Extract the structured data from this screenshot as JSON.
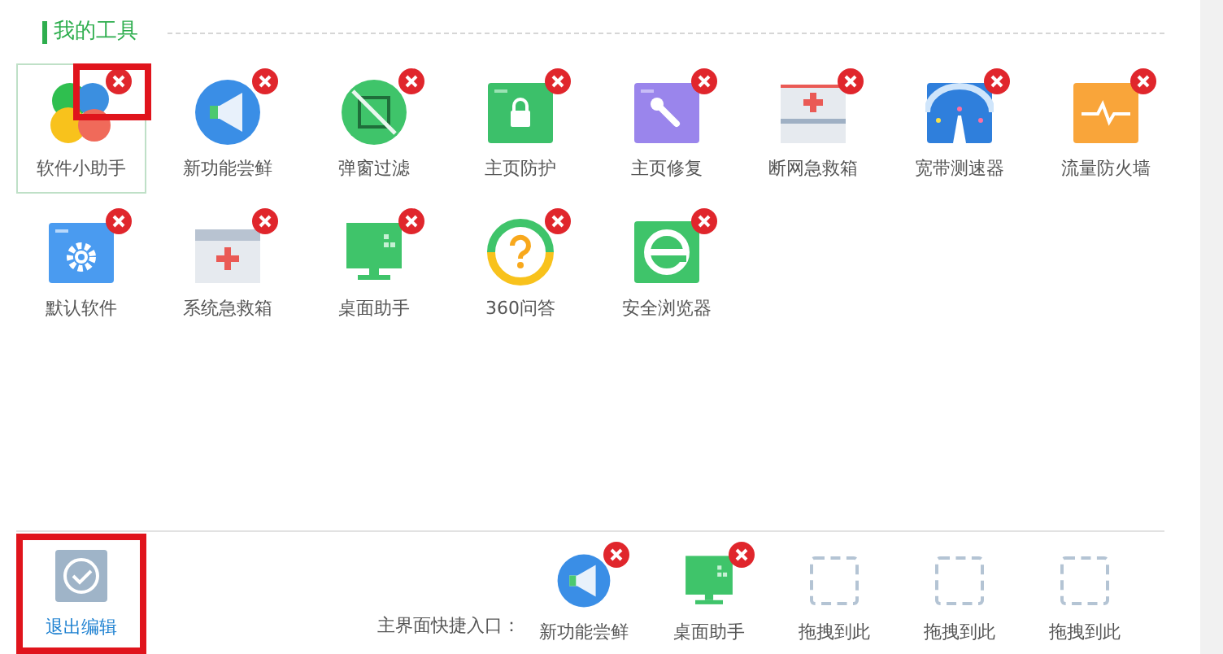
{
  "section": {
    "title": "我的工具"
  },
  "tools": [
    {
      "label": "软件小助手",
      "kind": "petals",
      "selected": true,
      "highlighted": true
    },
    {
      "label": "新功能尝鲜",
      "kind": "megaphone",
      "selected": false,
      "highlighted": false
    },
    {
      "label": "弹窗过滤",
      "kind": "nopopup",
      "selected": false,
      "highlighted": false
    },
    {
      "label": "主页防护",
      "kind": "lock",
      "selected": false,
      "highlighted": false
    },
    {
      "label": "主页修复",
      "kind": "wrench",
      "selected": false,
      "highlighted": false
    },
    {
      "label": "断网急救箱",
      "kind": "kit",
      "selected": false,
      "highlighted": false
    },
    {
      "label": "宽带测速器",
      "kind": "speed",
      "selected": false,
      "highlighted": false
    },
    {
      "label": "流量防火墙",
      "kind": "pulse",
      "selected": false,
      "highlighted": false
    },
    {
      "label": "默认软件",
      "kind": "gear",
      "selected": false,
      "highlighted": false
    },
    {
      "label": "系统急救箱",
      "kind": "kit2",
      "selected": false,
      "highlighted": false
    },
    {
      "label": "桌面助手",
      "kind": "monitor",
      "selected": false,
      "highlighted": false
    },
    {
      "label": "360问答",
      "kind": "question",
      "selected": false,
      "highlighted": false
    },
    {
      "label": "安全浏览器",
      "kind": "browser",
      "selected": false,
      "highlighted": false
    }
  ],
  "exit_edit": {
    "label": "退出编辑",
    "highlighted": true
  },
  "shortcuts": {
    "label": "主界面快捷入口：",
    "items": [
      {
        "label": "新功能尝鲜",
        "kind": "megaphone"
      },
      {
        "label": "桌面助手",
        "kind": "monitor"
      },
      {
        "label": "拖拽到此",
        "kind": "empty"
      },
      {
        "label": "拖拽到此",
        "kind": "empty"
      },
      {
        "label": "拖拽到此",
        "kind": "empty"
      }
    ]
  }
}
